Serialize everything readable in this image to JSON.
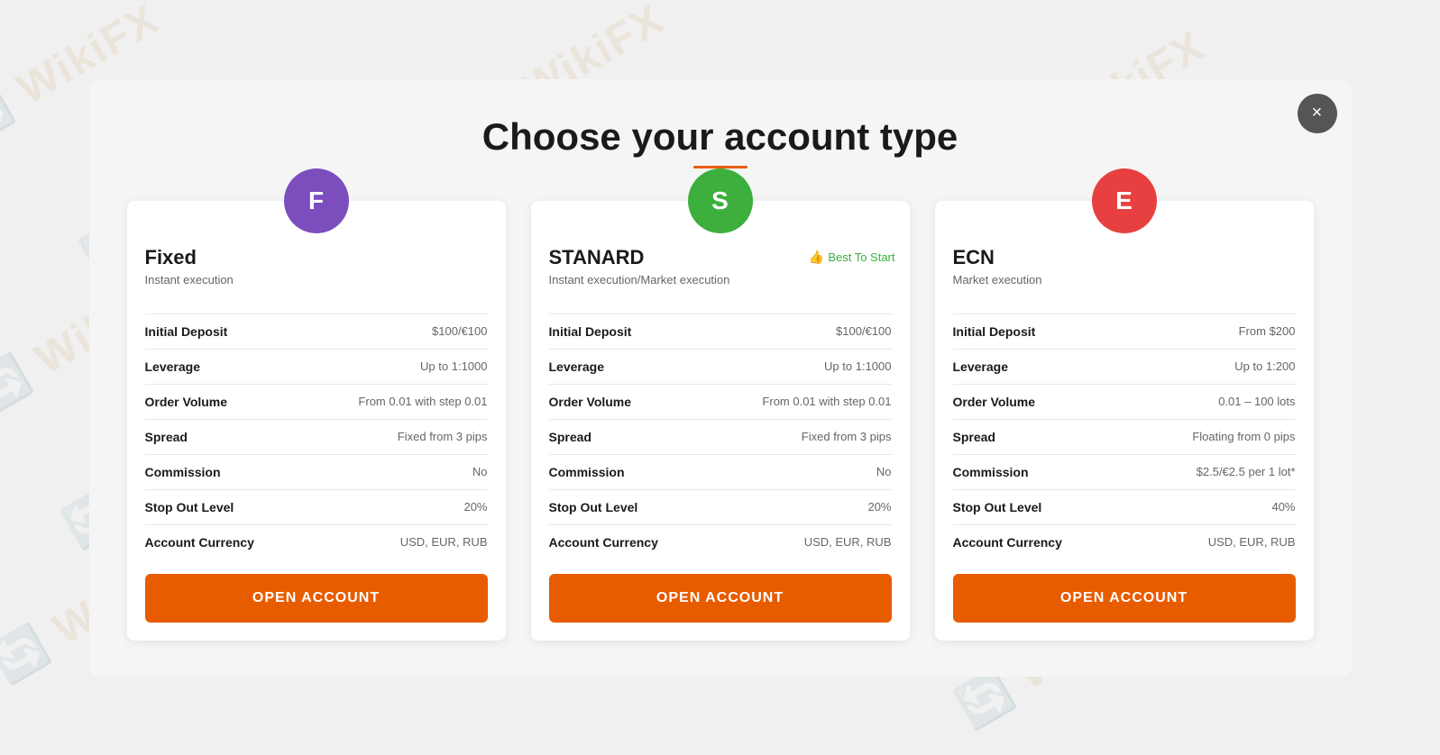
{
  "page": {
    "title": "Choose your account type",
    "title_underline": true,
    "close_button_label": "×"
  },
  "watermark": {
    "text": "WikiFX"
  },
  "cards": [
    {
      "id": "fixed",
      "avatar_letter": "F",
      "avatar_class": "avatar-purple",
      "title": "Fixed",
      "subtitle": "Instant execution",
      "best_to_start": false,
      "rows": [
        {
          "label": "Initial Deposit",
          "value": "$100/€100"
        },
        {
          "label": "Leverage",
          "value": "Up to 1:1000"
        },
        {
          "label": "Order Volume",
          "value": "From 0.01 with step 0.01"
        },
        {
          "label": "Spread",
          "value": "Fixed from 3 pips"
        },
        {
          "label": "Commission",
          "value": "No"
        },
        {
          "label": "Stop Out Level",
          "value": "20%"
        },
        {
          "label": "Account Currency",
          "value": "USD, EUR, RUB"
        }
      ],
      "button_label": "OPEN ACCOUNT"
    },
    {
      "id": "standard",
      "avatar_letter": "S",
      "avatar_class": "avatar-green",
      "title": "STANARD",
      "subtitle": "Instant execution/Market execution",
      "best_to_start": true,
      "best_to_start_label": "Best To Start",
      "rows": [
        {
          "label": "Initial Deposit",
          "value": "$100/€100"
        },
        {
          "label": "Leverage",
          "value": "Up to 1:1000"
        },
        {
          "label": "Order Volume",
          "value": "From 0.01 with step 0.01"
        },
        {
          "label": "Spread",
          "value": "Fixed from 3 pips"
        },
        {
          "label": "Commission",
          "value": "No"
        },
        {
          "label": "Stop Out Level",
          "value": "20%"
        },
        {
          "label": "Account Currency",
          "value": "USD, EUR, RUB"
        }
      ],
      "button_label": "OPEN ACCOUNT"
    },
    {
      "id": "ecn",
      "avatar_letter": "E",
      "avatar_class": "avatar-red",
      "title": "ECN",
      "subtitle": "Market execution",
      "best_to_start": false,
      "rows": [
        {
          "label": "Initial Deposit",
          "value": "From $200"
        },
        {
          "label": "Leverage",
          "value": "Up to 1:200"
        },
        {
          "label": "Order Volume",
          "value": "0.01 – 100 lots"
        },
        {
          "label": "Spread",
          "value": "Floating from 0 pips"
        },
        {
          "label": "Commission",
          "value": "$2.5/€2.5 per 1 lot*"
        },
        {
          "label": "Stop Out Level",
          "value": "40%"
        },
        {
          "label": "Account Currency",
          "value": "USD, EUR, RUB"
        }
      ],
      "button_label": "OPEN ACCOUNT"
    }
  ]
}
